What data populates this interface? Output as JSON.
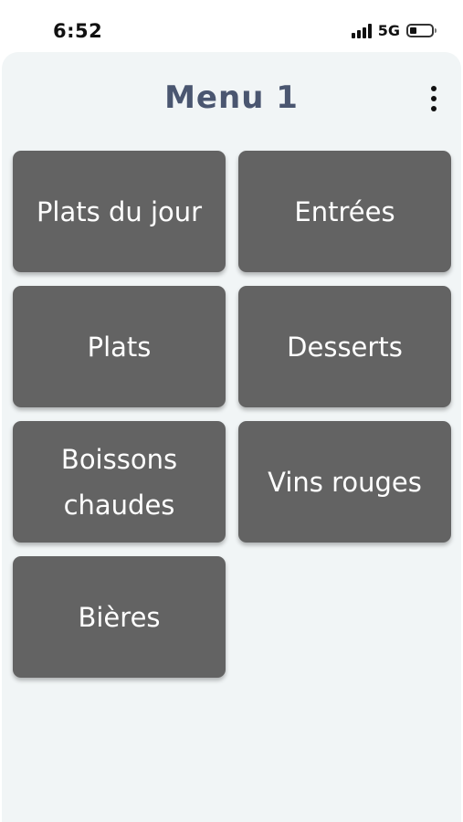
{
  "status_bar": {
    "time": "6:52",
    "network": "5G",
    "battery_level": 0.3
  },
  "header": {
    "title": "Menu 1",
    "more_icon": "more-vertical-icon"
  },
  "categories": [
    {
      "label": "Plats du jour"
    },
    {
      "label": "Entrées"
    },
    {
      "label": "Plats"
    },
    {
      "label": "Desserts"
    },
    {
      "label": "Boissons chaudes"
    },
    {
      "label": "Vins rouges"
    },
    {
      "label": "Bières"
    }
  ],
  "colors": {
    "tile_background": "#636363",
    "app_background": "#f1f5f6",
    "title_color": "#4a5670"
  }
}
